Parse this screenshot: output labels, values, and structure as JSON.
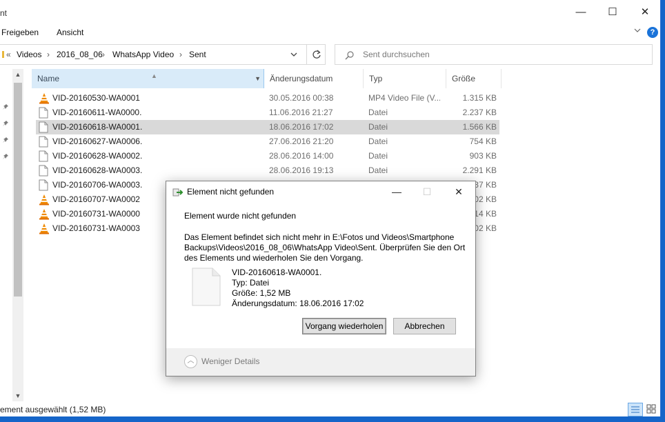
{
  "window": {
    "title_fragment": "nt",
    "controls": {
      "minimize": "—",
      "maximize": "☐",
      "close": "✕"
    }
  },
  "ribbon": {
    "tabs": [
      "Freigeben",
      "Ansicht"
    ],
    "help": "?"
  },
  "address": {
    "crumbs": [
      "Videos",
      "2016_08_06",
      "WhatsApp Video",
      "Sent"
    ],
    "overflow": "«"
  },
  "search": {
    "placeholder": "Sent durchsuchen"
  },
  "columns": {
    "name": "Name",
    "date": "Änderungsdatum",
    "type": "Typ",
    "size": "Größe"
  },
  "files": [
    {
      "name": "VID-20160530-WA0001",
      "date": "30.05.2016 00:38",
      "type": "MP4 Video File (V...",
      "size": "1.315 KB",
      "icon": "vlc-icon",
      "selected": false
    },
    {
      "name": "VID-20160611-WA0000.",
      "date": "11.06.2016 21:27",
      "type": "Datei",
      "size": "2.237 KB",
      "icon": "file-icon",
      "selected": false
    },
    {
      "name": "VID-20160618-WA0001.",
      "date": "18.06.2016 17:02",
      "type": "Datei",
      "size": "1.566 KB",
      "icon": "file-icon",
      "selected": true
    },
    {
      "name": "VID-20160627-WA0006.",
      "date": "27.06.2016 21:20",
      "type": "Datei",
      "size": "754 KB",
      "icon": "file-icon",
      "selected": false
    },
    {
      "name": "VID-20160628-WA0002.",
      "date": "28.06.2016 14:00",
      "type": "Datei",
      "size": "903 KB",
      "icon": "file-icon",
      "selected": false
    },
    {
      "name": "VID-20160628-WA0003.",
      "date": "28.06.2016 19:13",
      "type": "Datei",
      "size": "2.291 KB",
      "icon": "file-icon",
      "selected": false
    },
    {
      "name": "VID-20160706-WA0003.",
      "date": "",
      "type": "",
      "size": "637 KB",
      "icon": "file-icon",
      "selected": false
    },
    {
      "name": "VID-20160707-WA0002",
      "date": "",
      "type": "",
      "size": "002 KB",
      "icon": "vlc-icon",
      "selected": false
    },
    {
      "name": "VID-20160731-WA0000",
      "date": "",
      "type": "",
      "size": "514 KB",
      "icon": "vlc-icon",
      "selected": false
    },
    {
      "name": "VID-20160731-WA0003",
      "date": "",
      "type": "",
      "size": "502 KB",
      "icon": "vlc-icon",
      "selected": false
    }
  ],
  "status": {
    "text": "ement ausgewählt (1,52 MB)"
  },
  "dialog": {
    "title": "Element nicht gefunden",
    "heading": "Element wurde nicht gefunden",
    "message": "Das Element befindet sich nicht mehr in E:\\Fotos und Videos\\Smartphone Backups\\Videos\\2016_08_06\\WhatsApp Video\\Sent. Überprüfen Sie den Ort des Elements und wiederholen Sie den Vorgang.",
    "file_name": "VID-20160618-WA0001.",
    "file_type": "Typ: Datei",
    "file_size": "Größe: 1,52 MB",
    "file_date": "Änderungsdatum: 18.06.2016 17:02",
    "retry_label": "Vorgang wiederholen",
    "cancel_label": "Abbrechen",
    "less_details": "Weniger Details"
  },
  "colors": {
    "accent": "#1a73d9",
    "selection": "#d9d9d9",
    "header_active": "#d9ebf9",
    "vlc_orange": "#f08a00"
  }
}
